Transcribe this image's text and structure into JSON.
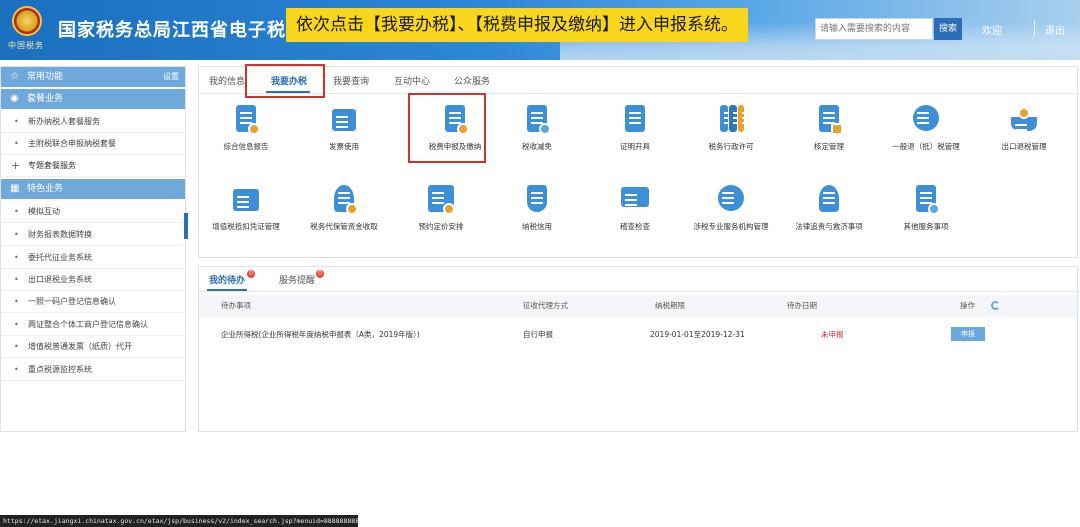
{
  "header": {
    "emblem_caption": "中国税务",
    "site_title": "国家税务总局江西省电子税务局",
    "instruction_banner": "依次点击【我要办税】、【税费申报及缴纳】进入申报系统。",
    "search_placeholder": "请输入需要搜索的内容",
    "search_button": "搜索",
    "welcome": "欢迎",
    "logout": "退出"
  },
  "sidebar": {
    "common_title": "常用功能",
    "settings": "设置",
    "package_title": "套餐业务",
    "package_items": [
      "新办纳税人套餐服务",
      "主附税联合申报纳税套餐"
    ],
    "special_package": "专题套餐服务",
    "feature_title": "特色业务",
    "feature_items": [
      "模拟互动",
      "财务报表数据转换",
      "委托代征业务系统",
      "出口退税业务系统",
      "一照一码户登记信息确认",
      "两证整合个体工商户登记信息确认",
      "增值税普通发票（纸质）代开",
      "重点税源监控系统"
    ]
  },
  "tabs": [
    "我的信息",
    "我要办税",
    "我要查询",
    "互动中心",
    "公众服务"
  ],
  "active_tab": "我要办税",
  "services": [
    {
      "label": "综合信息报告",
      "icon": "report-icon",
      "color": "#3d8fd8"
    },
    {
      "label": "发票使用",
      "icon": "invoice-printer-icon",
      "color": "#3d8fd8"
    },
    {
      "label": "税费申报及缴纳",
      "icon": "tax-declaration-icon",
      "color": "#3d8fd8"
    },
    {
      "label": "税收减免",
      "icon": "tax-relief-icon",
      "color": "#3d8fd8"
    },
    {
      "label": "证明开具",
      "icon": "certificate-icon",
      "color": "#3d8fd8"
    },
    {
      "label": "税务行政许可",
      "icon": "permit-binders-icon",
      "color": "#3d8fd8"
    },
    {
      "label": "核定管理",
      "icon": "verification-icon",
      "color": "#3d8fd8"
    },
    {
      "label": "一般退（抵）税管理",
      "icon": "refund-icon",
      "color": "#3d8fd8"
    },
    {
      "label": "出口退税管理",
      "icon": "export-ship-icon",
      "color": "#3d8fd8"
    },
    {
      "label": "增值税抵扣凭证管理",
      "icon": "vat-deduction-icon",
      "color": "#3d8fd8"
    },
    {
      "label": "税务代保管资金收取",
      "icon": "custody-funds-icon",
      "color": "#3d8fd8"
    },
    {
      "label": "预约定价安排",
      "icon": "calendar-icon",
      "color": "#3d8fd8"
    },
    {
      "label": "纳税信用",
      "icon": "credit-shield-icon",
      "color": "#3d8fd8"
    },
    {
      "label": "稽查检查",
      "icon": "inspection-monitor-icon",
      "color": "#3d8fd8"
    },
    {
      "label": "涉税专业服务机构管理",
      "icon": "professional-service-icon",
      "color": "#3d8fd8"
    },
    {
      "label": "法律追责与救济事项",
      "icon": "legal-person-icon",
      "color": "#3d8fd8"
    },
    {
      "label": "其他服务事项",
      "icon": "other-services-icon",
      "color": "#3d8fd8"
    }
  ],
  "todo": {
    "tab_mine": "我的待办",
    "tab_mine_count": "0",
    "tab_reminder": "服务提醒",
    "tab_reminder_count": "0",
    "columns": [
      "待办事项",
      "征收代理方式",
      "纳税期限",
      "待办日期",
      "操作"
    ],
    "rows": [
      {
        "item": "企业所得税(企业所得税年度纳税申报表（A类，2019年版）)",
        "method": "自行申报",
        "period": "2019-01-01至2019-12-31",
        "status": "未申报",
        "action": "申报"
      }
    ]
  },
  "status_url": "https://etax.jiangxi.chinatax.gov.cn/etax/jsp/business/v2/index_search.jsp?menuid=8888888888888888888..."
}
